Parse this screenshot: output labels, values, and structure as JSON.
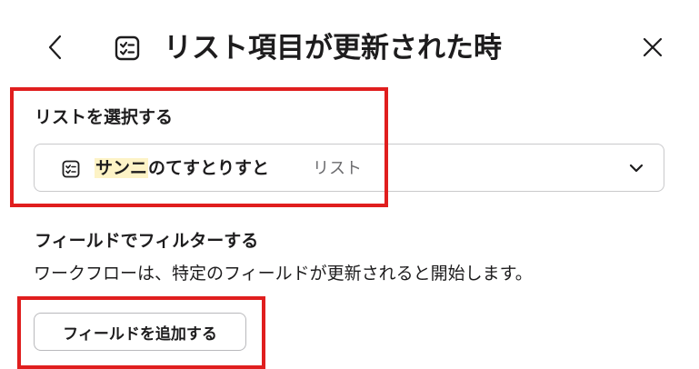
{
  "header": {
    "title": "リスト項目が更新された時",
    "back_icon": "chevron-left-icon",
    "list_icon": "list-check-icon",
    "close_icon": "close-icon"
  },
  "list_select": {
    "label": "リストを選択する",
    "selected_name_highlight": "サンニ",
    "selected_name_rest": "のてすとりすと",
    "selected_type": "リスト",
    "item_icon": "list-check-icon",
    "dropdown_icon": "chevron-down-icon"
  },
  "filter": {
    "label": "フィールドでフィルターする",
    "description": "ワークフローは、特定のフィールドが更新されると開始します。",
    "add_button_label": "フィールドを追加する"
  },
  "colors": {
    "annotation": "#e01e1e",
    "highlight": "#fdf3c6",
    "border": "#c9c9cb",
    "text": "#1d1c1d",
    "muted": "#6b6b6e"
  }
}
